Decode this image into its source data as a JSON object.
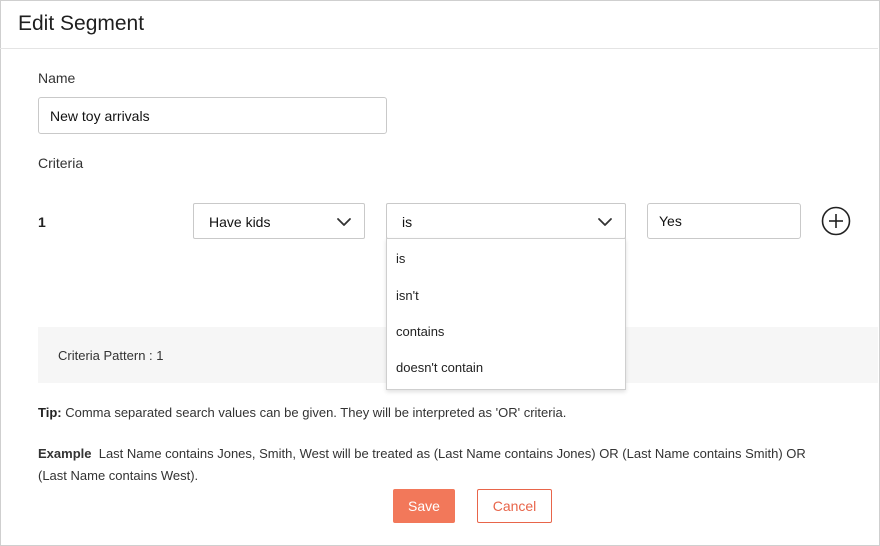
{
  "header": {
    "title": "Edit Segment"
  },
  "form": {
    "name_label": "Name",
    "name_value": "New toy arrivals",
    "criteria_label": "Criteria"
  },
  "criteria": {
    "rows": [
      {
        "number": "1",
        "field": "Have kids",
        "operator": "is",
        "value": "Yes"
      }
    ]
  },
  "operator_dropdown": {
    "options": [
      "is",
      "isn't",
      "contains",
      "doesn't contain"
    ]
  },
  "pattern": {
    "text": "Criteria Pattern : 1"
  },
  "tip": {
    "label": "Tip:",
    "text": " Comma separated search values can be given. They will be interpreted as 'OR' criteria."
  },
  "example": {
    "label": "Example",
    "text": "  Last Name contains Jones, Smith, West will be treated as (Last Name contains Jones) OR (Last Name contains Smith) OR (Last Name contains West)."
  },
  "buttons": {
    "save": "Save",
    "cancel": "Cancel"
  },
  "colors": {
    "accent": "#f2785a",
    "cancel_text": "#e8654a",
    "pattern_bg": "#f6f6f6"
  },
  "icons": {
    "dropdown": "chevron-down-icon",
    "add": "plus-circle-icon"
  }
}
